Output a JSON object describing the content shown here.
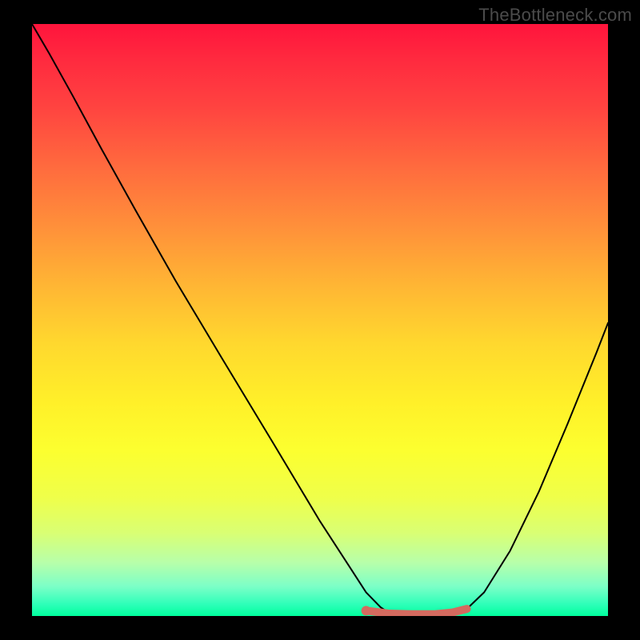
{
  "watermark": "TheBottleneck.com",
  "chart_data": {
    "type": "line",
    "title": "",
    "xlabel": "",
    "ylabel": "",
    "xlim": [
      0,
      100
    ],
    "ylim": [
      0,
      100
    ],
    "gradient_stops": [
      {
        "pos": 0,
        "color": "#ff143c"
      },
      {
        "pos": 6,
        "color": "#ff2a3f"
      },
      {
        "pos": 14,
        "color": "#ff4340"
      },
      {
        "pos": 24,
        "color": "#ff6a3e"
      },
      {
        "pos": 34,
        "color": "#ff8f3a"
      },
      {
        "pos": 44,
        "color": "#ffb534"
      },
      {
        "pos": 54,
        "color": "#ffd82e"
      },
      {
        "pos": 64,
        "color": "#fff029"
      },
      {
        "pos": 72,
        "color": "#fcff2f"
      },
      {
        "pos": 80,
        "color": "#efff4a"
      },
      {
        "pos": 86,
        "color": "#d9ff74"
      },
      {
        "pos": 91,
        "color": "#b7ffaa"
      },
      {
        "pos": 95,
        "color": "#7cffc7"
      },
      {
        "pos": 98,
        "color": "#2effb9"
      },
      {
        "pos": 100,
        "color": "#00ff9d"
      }
    ],
    "series": [
      {
        "name": "bottleneck-curve",
        "color": "#000000",
        "width": 2,
        "x": [
          0.0,
          3.0,
          7.0,
          12.0,
          18.0,
          25.0,
          33.0,
          42.0,
          50.0,
          55.0,
          58.0,
          60.5,
          62.0,
          66.0,
          70.0,
          73.0,
          75.5,
          78.5,
          83.0,
          88.0,
          93.0,
          98.0,
          100.0
        ],
        "y": [
          100.0,
          95.0,
          88.0,
          79.0,
          68.5,
          56.5,
          43.5,
          29.0,
          16.0,
          8.5,
          4.0,
          1.5,
          0.5,
          0.2,
          0.1,
          0.3,
          1.2,
          4.0,
          11.0,
          21.0,
          32.5,
          44.5,
          49.5
        ]
      },
      {
        "name": "optimal-zone",
        "color": "#d46a5f",
        "width": 10,
        "x": [
          58.0,
          60.5,
          62.0,
          66.0,
          70.0,
          73.0,
          75.5
        ],
        "y": [
          0.9,
          0.6,
          0.4,
          0.3,
          0.3,
          0.6,
          1.2
        ]
      }
    ],
    "marker": {
      "name": "optimal-start-dot",
      "color": "#d46a5f",
      "x": 58.0,
      "y": 0.9,
      "r": 6
    }
  }
}
